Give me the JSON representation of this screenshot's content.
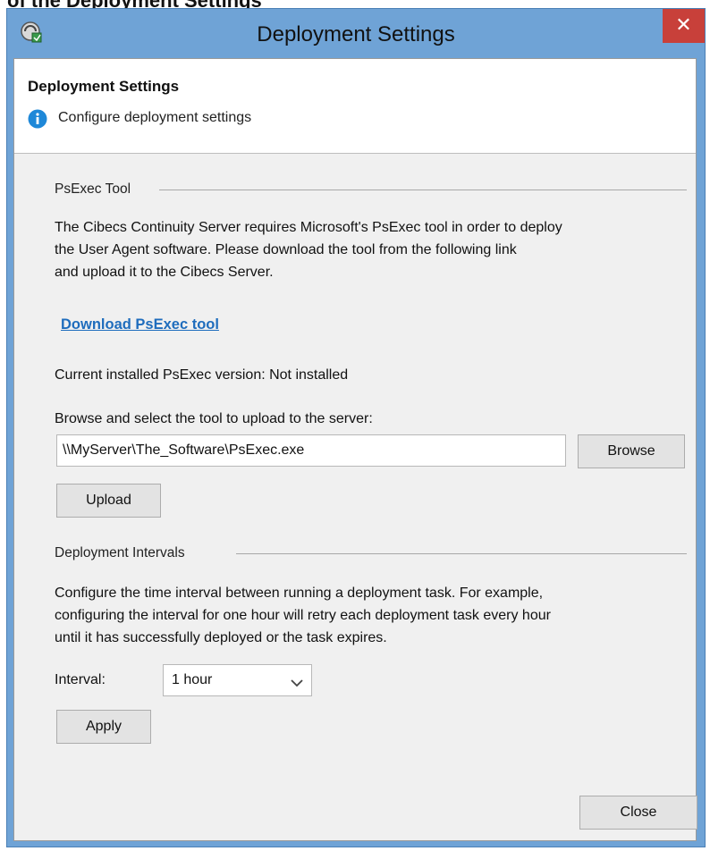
{
  "partial_caption": "of the Deployment Settings",
  "window": {
    "title": "Deployment Settings",
    "close_glyph": "✕"
  },
  "header": {
    "title": "Deployment Settings",
    "subtitle": "Configure deployment settings"
  },
  "psexec": {
    "group_label": "PsExec Tool",
    "description": "The Cibecs Continuity Server requires Microsoft's PsExec tool in order to deploy\nthe User Agent software. Please download the tool from the following link\nand upload it to the Cibecs Server.",
    "download_link": "Download PsExec tool",
    "installed_version": "Current installed PsExec version: Not installed",
    "browse_prompt": "Browse and select the tool to upload to the server:",
    "path_value": "\\\\MyServer\\The_Software\\PsExec.exe",
    "browse_label": "Browse",
    "upload_label": "Upload"
  },
  "intervals": {
    "group_label": "Deployment Intervals",
    "description": "Configure the time interval between running a deployment task. For example,\nconfiguring the interval for one hour will retry each deployment task every hour\nuntil it has successfully deployed or the task expires.",
    "interval_label": "Interval:",
    "interval_value": "1 hour",
    "apply_label": "Apply"
  },
  "footer": {
    "close_label": "Close"
  },
  "colors": {
    "window_frame": "#6fa3d6",
    "close_button": "#c8403a",
    "link": "#1f6dbd",
    "info_icon": "#1e88d8"
  },
  "icons": [
    "app-icon",
    "close-icon",
    "info-icon",
    "chevron-down-icon"
  ]
}
